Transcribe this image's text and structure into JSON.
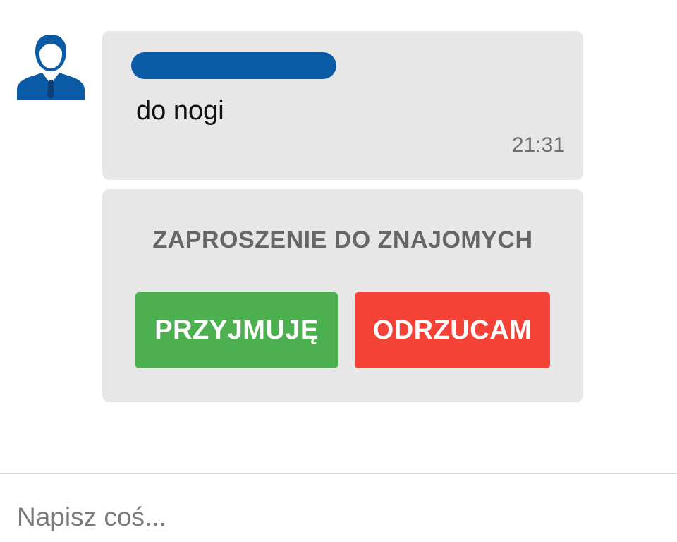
{
  "message": {
    "sender_name_redacted": true,
    "text": "do nogi",
    "time": "21:31"
  },
  "invitation": {
    "title": "ZAPROSZENIE DO ZNAJOMYCH",
    "accept_label": "PRZYJMUJĘ",
    "reject_label": "ODRZUCAM"
  },
  "composer": {
    "placeholder": "Napisz coś..."
  },
  "icons": {
    "avatar": "user-avatar-icon"
  },
  "colors": {
    "avatar_blue": "#0a5aa6",
    "bubble_bg": "#e7e7e7",
    "accept_green": "#4caf50",
    "reject_red": "#f44336"
  }
}
